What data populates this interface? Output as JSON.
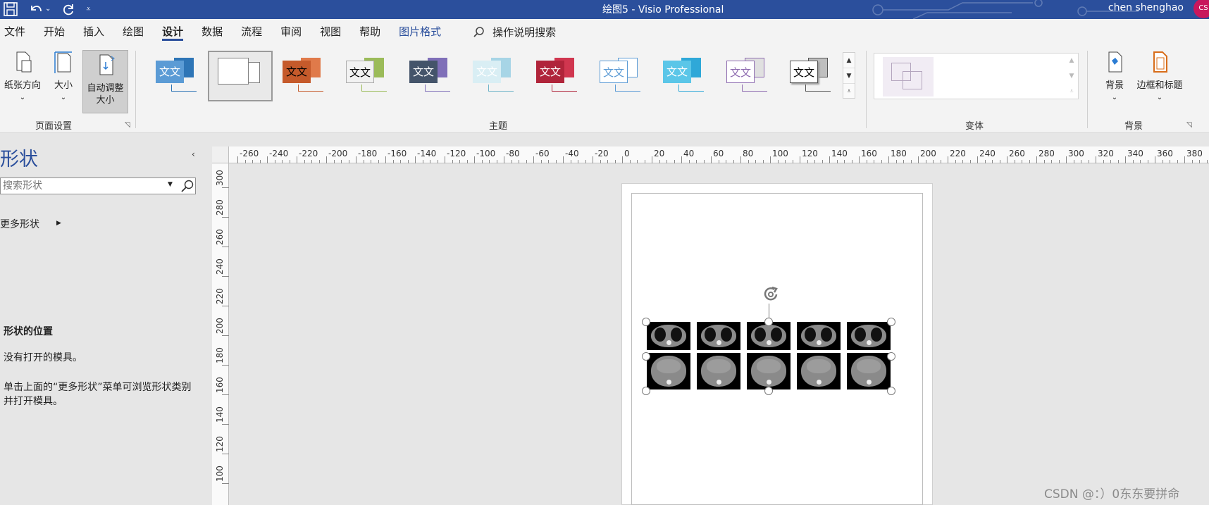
{
  "titlebar": {
    "doc_title": "绘图5  -  Visio Professional",
    "user_name": "chen shenghao",
    "avatar_initials": "CS",
    "colors": {
      "bar": "#2b4f9c",
      "avatar": "#c8175d"
    },
    "qat_icons": [
      "save-icon",
      "undo-icon",
      "undo-dropdown-icon",
      "redo-icon",
      "customize-qat-icon"
    ]
  },
  "ribbon_tabs": [
    {
      "label": "文件"
    },
    {
      "label": "开始"
    },
    {
      "label": "插入"
    },
    {
      "label": "绘图"
    },
    {
      "label": "设计",
      "active": true
    },
    {
      "label": "数据"
    },
    {
      "label": "流程"
    },
    {
      "label": "审阅"
    },
    {
      "label": "视图"
    },
    {
      "label": "帮助"
    },
    {
      "label": "图片格式",
      "contextual": true
    }
  ],
  "tell_me": {
    "label": "操作说明搜索",
    "icon": "search-icon"
  },
  "page_setup": {
    "group_label": "页面设置",
    "orientation": "纸张方向",
    "size": "大小",
    "auto_size_line1": "自动调整",
    "auto_size_line2": "大小"
  },
  "themes": {
    "group_label": "主题",
    "items": [
      {
        "text": "文文",
        "front": "#5b9bd5",
        "back": "#2e75b6",
        "line": "#2e75b6",
        "text_color": "#ffffff"
      },
      {
        "text": "",
        "front": "#ffffff",
        "back": "#ffffff",
        "line": "#7f7f7f",
        "text_color": "#000000"
      },
      {
        "text": "文文",
        "front": "#c55a2b",
        "back": "#e07a4a",
        "line": "#c55a2b",
        "text_color": "#ffffff"
      },
      {
        "text": "文文",
        "front": "#f2f2f2",
        "back": "#9bbb59",
        "line": "#9bbb59",
        "text_color": "#000000"
      },
      {
        "text": "文文",
        "front": "#44546a",
        "back": "#7f6fb8",
        "line": "#7f6fb8",
        "text_color": "#ffffff"
      },
      {
        "text": "文文",
        "front": "#d9eef4",
        "back": "#a7d5e6",
        "line": "#6fb4c9",
        "text_color": "#ffffff"
      },
      {
        "text": "文文",
        "front": "#b0243a",
        "back": "#d0364f",
        "line": "#b0243a",
        "text_color": "#ffffff"
      },
      {
        "text": "文文",
        "front": "#ffffff",
        "back": "#ffffff",
        "line": "#5b9bd5",
        "text_color": "#5b9bd5"
      },
      {
        "text": "文文",
        "front": "#5bc6e8",
        "back": "#2fa8d8",
        "line": "#2fa8d8",
        "text_color": "#ffffff"
      },
      {
        "text": "文文",
        "front": "#ffffff",
        "back": "#e0e0e0",
        "line": "#8e6bb0",
        "text_color": "#8e6bb0"
      },
      {
        "text": "文文",
        "front": "#ffffff",
        "back": "#bfbfbf",
        "line": "#555555",
        "text_color": "#000000"
      }
    ]
  },
  "variants": {
    "group_label": "变体"
  },
  "backgrounds": {
    "group_label": "背景",
    "background_button": "背景",
    "borders_button": "边框和标题"
  },
  "shapes_pane": {
    "title": "形状",
    "search_placeholder": "搜索形状",
    "more_shapes": "更多形状",
    "location_title": "形状的位置",
    "location_none": "没有打开的模具。",
    "location_help": "单击上面的“更多形状”菜单可浏览形状类别并打开模具。"
  },
  "ruler": {
    "h_labels": [
      "-260",
      "-240",
      "-220",
      "-200",
      "-180",
      "-160",
      "-140",
      "-120",
      "-100",
      "-80",
      "-60",
      "-40",
      "-20",
      "0",
      "20",
      "40",
      "60",
      "80",
      "100",
      "120",
      "140",
      "160",
      "180",
      "200",
      "220",
      "240",
      "260",
      "280",
      "300",
      "320",
      "340",
      "360",
      "380"
    ],
    "v_labels": [
      "300",
      "280",
      "260",
      "240",
      "220",
      "200",
      "180",
      "160",
      "140",
      "120",
      "100"
    ]
  },
  "picture": {
    "rows": [
      {
        "kind": "lung",
        "count": 5
      },
      {
        "kind": "abdomen",
        "count": 5
      }
    ]
  },
  "watermark": "CSDN @：）0东东要拼命"
}
